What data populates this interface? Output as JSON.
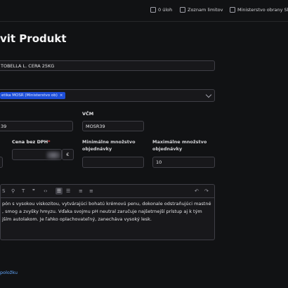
{
  "topbar": {
    "tasks": "0 úloh",
    "limits": "Zoznam limitov",
    "ministry": "Ministerstvo obrany Slo"
  },
  "page_title": "vit Produkt",
  "name_value": "TOBELLA L. CERA 25KG",
  "category_tag": "etika MOSR (Ministerstvo ob)",
  "category_tag_remove": "×",
  "vcm_label": "VČM",
  "vcm_value": "MOSR39",
  "code_value": "39",
  "price_label": "Cena bez DPH",
  "price_required": "*",
  "currency": "€",
  "min_qty_label": "Minimálne množstvo objednávky",
  "max_qty_label": "Maximálne množstvo objednávky",
  "max_qty_value": "10",
  "description_text": "pón s vysokou viskozitou, vytvárajúci bohatú krémovú penu, dokonale odstraňujúci mastné , smog a zvyšky hmyzu. Vďaka svojmu pH neutral zaručuje najšetrnejší prístup aj k tým jším autolakom. Je ľahko oplachovateľný, zanecháva vysoký lesk.",
  "add_item_link": "položku",
  "toolbar_icons": [
    "strike-icon",
    "link-icon",
    "heading-icon",
    "quote-icon",
    "code-icon",
    "bullet-list-icon",
    "ordered-list-icon",
    "indent-icon",
    "outdent-icon",
    "undo-icon",
    "redo-icon"
  ],
  "colors": {
    "background": "#111214",
    "accent": "#1d4ed8",
    "link": "#60a5fa",
    "required": "#ef4444"
  }
}
